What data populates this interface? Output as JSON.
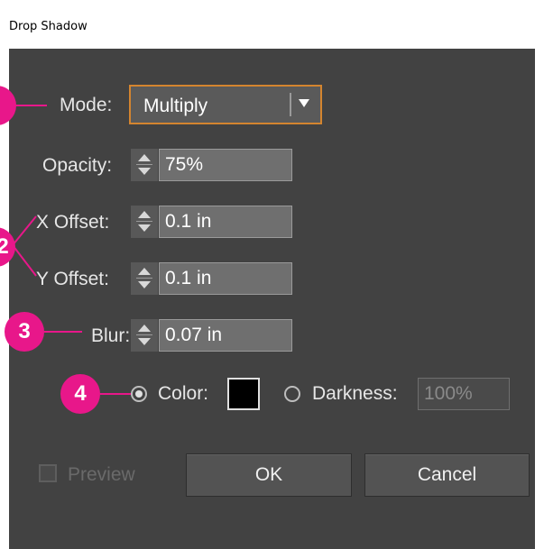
{
  "window": {
    "title": "Drop Shadow"
  },
  "mode": {
    "label": "Mode:",
    "value": "Multiply"
  },
  "opacity": {
    "label": "Opacity:",
    "value": "75%"
  },
  "x_offset": {
    "label": "X Offset:",
    "value": "0.1 in"
  },
  "y_offset": {
    "label": "Y Offset:",
    "value": "0.1 in"
  },
  "blur": {
    "label": "Blur:",
    "value": "0.07 in"
  },
  "color_option": {
    "label": "Color:",
    "selected": true,
    "swatch": "#000000"
  },
  "darkness_option": {
    "label": "Darkness:",
    "value": "100%",
    "selected": false
  },
  "preview": {
    "label": "Preview",
    "checked": false
  },
  "buttons": {
    "ok": "OK",
    "cancel": "Cancel"
  },
  "callouts": [
    "2",
    "3",
    "4"
  ],
  "colors": {
    "accent": "#e8178a",
    "panel": "#424242",
    "focus": "#d4852f"
  }
}
